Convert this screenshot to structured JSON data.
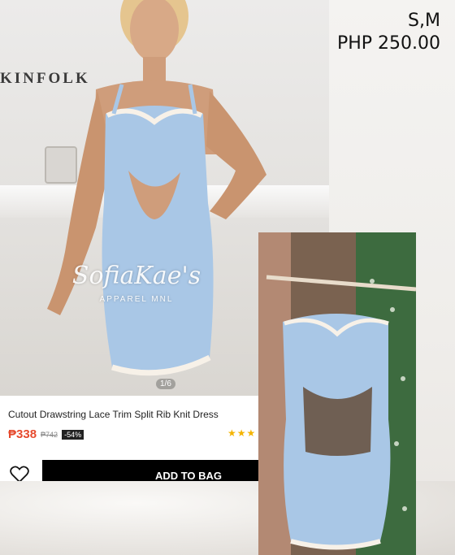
{
  "caption": {
    "sizes": "S,M",
    "price": "PHP 250.00"
  },
  "product": {
    "wall_sign": "KINFOLK",
    "watermark_script": "SofiaKae's",
    "watermark_sub": "APPAREL MNL",
    "image_indicator": "1/6",
    "title": "Cutout Drawstring Lace Trim Split Rib Knit Dress",
    "price": "₱338",
    "original_price": "₱742",
    "discount": "-54%",
    "stars": "★★★",
    "add_to_bag_label": "ADD TO BAG"
  },
  "colors": {
    "dress": "#a9c7e6",
    "price": "#e64a2e",
    "button": "#000000",
    "stars": "#f4b400"
  }
}
